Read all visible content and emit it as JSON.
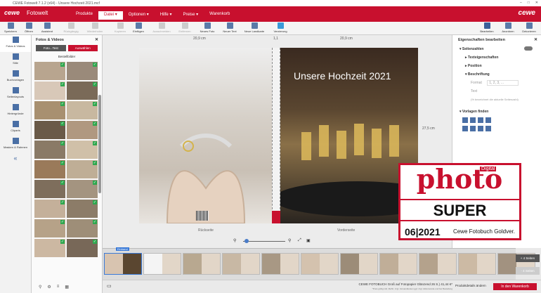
{
  "window": {
    "title": "CEWE Fotowelt 7.1.2 (x64) - Unsere Hochzeit 2021.mcf",
    "controls": [
      "–",
      "□",
      "✕"
    ]
  },
  "header": {
    "logo": "cewe",
    "app_name": "Fotowelt",
    "brand": "cewe",
    "menu": [
      "Produkte",
      "Datei",
      "Optionen",
      "Hilfe",
      "Preise",
      "Warenkorb"
    ],
    "menu_arrows": [
      "▾",
      "▾",
      "▾",
      "▾"
    ]
  },
  "toolbar": {
    "items": [
      "Speichern",
      "Öffnen",
      "Assistent",
      "Rückgängig",
      "Wiederholen",
      "Kopieren",
      "Einfügen",
      "Ausschneiden",
      "Entfernen",
      "Neues Foto",
      "Neuer Text",
      "Neue Landkarte",
      "Verzierung"
    ],
    "right": [
      "Bearbeiten",
      "Anordnen",
      "Dekorieren"
    ]
  },
  "left_nav": [
    "Fotos & Videos",
    "Stile",
    "Buchvorlagen",
    "Seitenlayouts",
    "Hintergründe",
    "Cliparts",
    "Masken & Rahmen"
  ],
  "left_nav_more": "«",
  "photos_panel": {
    "title": "Fotos & Videos",
    "close": "✕",
    "tabs": [
      "Foto...Test",
      "Auswählen"
    ],
    "subtitle": "Bestellbilder",
    "check": "✓"
  },
  "canvas": {
    "width_left": "20,9 cm",
    "spine_width": "1,1",
    "width_right": "20,9 cm",
    "height": "27,5 cm",
    "cover_title": "Unsere Hochzeit 2021",
    "label_back": "Rückseite",
    "label_front": "Vorderseite",
    "spine_text": "Unsere Hochzeit 2021",
    "zoom_minus": "⚲",
    "zoom_plus": "⚲"
  },
  "properties": {
    "title": "Eigenschaften bearbeiten",
    "close": "✕",
    "rows": [
      "Seitenzahlen",
      "Texteigenschaften",
      "Position",
      "Beschriftung"
    ],
    "format_label": "Format",
    "format_value": "1, 2, 3, ...",
    "text_label": "Text",
    "text_hint": "(% bezeichnet die aktuelle Seitenzahl)",
    "templates": "Vorlagen finden"
  },
  "badge": {
    "digital": "Digital",
    "photo": "photo",
    "rating": "SUPER",
    "date": "06|2021",
    "product": "Cewe Fotobuch Goldver."
  },
  "strip": {
    "einband": "Einband",
    "add_pages": "+ 4 Seiten",
    "remove_pages": "- 4 Seiten"
  },
  "status": {
    "product": "CEWE FOTOBUCH Groß auf Fotopapier Glänzend 26 S.) 41,44 €*",
    "note": "*Preis gültig inkl. MwSt. zzgl. Versandkosten ggf. zzgl. Aktionscode und bei Bestellung",
    "details": "Produktdetails ändern",
    "cart": "In den Warenkorb"
  },
  "colors": {
    "brand_red": "#c8102e",
    "check_green": "#2fa84f",
    "accent_blue": "#3a7ad8"
  }
}
